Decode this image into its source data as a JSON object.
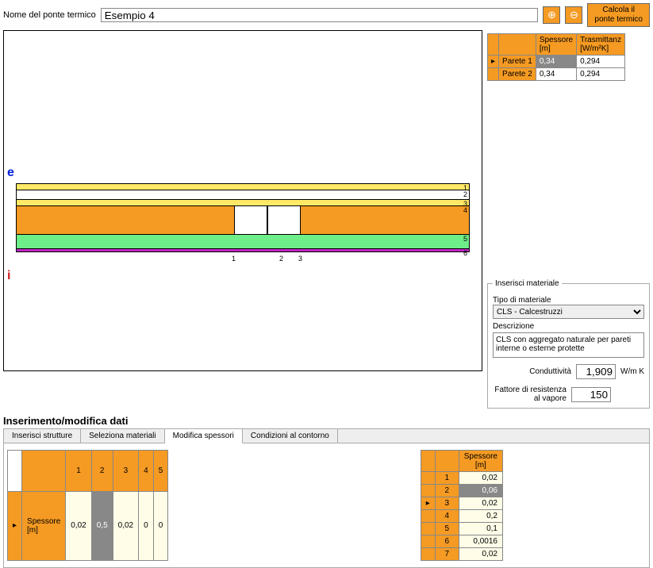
{
  "header": {
    "name_label": "Nome del ponte termico",
    "name_value": "Esempio 4",
    "calc_button": "Calcola il\nponte termico"
  },
  "canvas": {
    "e": "e",
    "i": "i",
    "h_marks": [
      "1",
      "2",
      "3"
    ],
    "v_marks": [
      "1",
      "2",
      "3",
      "4",
      "5",
      "6"
    ]
  },
  "walls": {
    "headers": [
      "",
      "",
      "Spessore\n[m]",
      "Trasmittanz\n[W/m²K]"
    ],
    "rows": [
      {
        "ptr": "▸",
        "name": "Parete 1",
        "sp": "0,34",
        "tr": "0,294",
        "sel": true
      },
      {
        "ptr": "",
        "name": "Parete 2",
        "sp": "0,34",
        "tr": "0,294",
        "sel": false
      }
    ]
  },
  "material": {
    "legend": "Inserisci materiale",
    "tipo_label": "Tipo di materiale",
    "tipo_value": "CLS - Calcestruzzi",
    "desc_label": "Descrizione",
    "desc_value": "CLS con aggregato naturale per pareti interne o esterne protette",
    "cond_label": "Conduttività",
    "cond_value": "1,909",
    "cond_unit": "W/m K",
    "vapor_label": "Fattore di resistenza\nal vapore",
    "vapor_value": "150"
  },
  "section_title": "Inserimento/modifica dati",
  "tabs": [
    "Inserisci strutture",
    "Seleziona materiali",
    "Modifica spessori",
    "Condizioni al contorno"
  ],
  "active_tab": 2,
  "h_table": {
    "cols": [
      "1",
      "2",
      "3",
      "4",
      "5"
    ],
    "row_label": "Spessore\n[m]",
    "row_ptr": "▸",
    "values": [
      "0,02",
      "0,5",
      "0,02",
      "0",
      "0"
    ],
    "sel_col": 1
  },
  "v_table": {
    "header": "Spessore\n[m]",
    "rows": [
      {
        "n": "1",
        "v": "0,02"
      },
      {
        "n": "2",
        "v": "0,06",
        "sel": true
      },
      {
        "n": "3",
        "v": "0,02",
        "ptr": true
      },
      {
        "n": "4",
        "v": "0,2"
      },
      {
        "n": "5",
        "v": "0,1"
      },
      {
        "n": "6",
        "v": "0,0016"
      },
      {
        "n": "7",
        "v": "0,02"
      }
    ]
  }
}
